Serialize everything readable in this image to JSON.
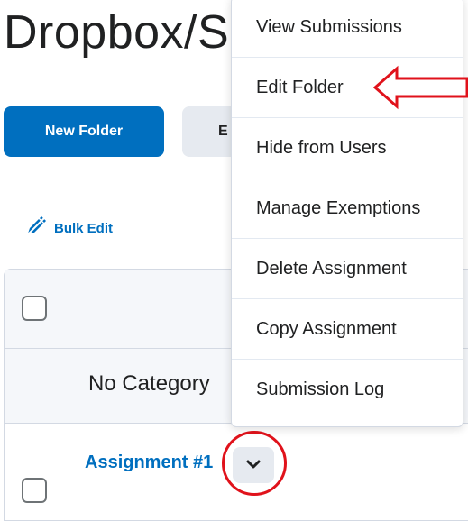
{
  "page": {
    "title": "Dropbox/S"
  },
  "toolbar": {
    "new_folder_label": "New Folder",
    "secondary_label": "E",
    "bulk_edit_label": "Bulk Edit"
  },
  "table": {
    "category_label": "No Category",
    "rows": [
      {
        "name": "Assignment #1"
      }
    ]
  },
  "context_menu": {
    "items": [
      {
        "label": "View Submissions"
      },
      {
        "label": "Edit Folder"
      },
      {
        "label": "Hide from Users"
      },
      {
        "label": "Manage Exemptions"
      },
      {
        "label": "Delete Assignment"
      },
      {
        "label": "Copy Assignment"
      },
      {
        "label": "Submission Log"
      }
    ]
  },
  "icons": {
    "bulk_edit": "pencil-edit-icon",
    "row_menu": "chevron-down-icon",
    "annotation_arrow": "left-arrow-annotation",
    "annotation_circle": "circle-annotation"
  },
  "colors": {
    "primary": "#006fbf",
    "annotation": "#e0121b",
    "button_secondary_bg": "#e6eaf0"
  }
}
